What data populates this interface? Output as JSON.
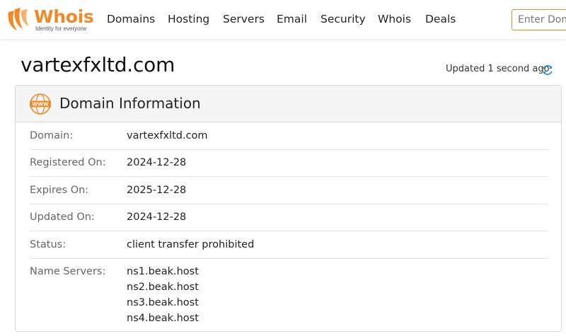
{
  "brand": {
    "name": "Whois",
    "tagline": "Identity for everyone",
    "color": "#f18a26"
  },
  "nav": {
    "items": [
      "Domains",
      "Hosting",
      "Servers",
      "Email",
      "Security",
      "Whois",
      "Deals"
    ]
  },
  "search": {
    "placeholder": "Enter Domain or IP"
  },
  "page": {
    "domain": "vartexfxltd.com",
    "updated_text": "Updated 1 second ago",
    "refresh_icon": "refresh-icon"
  },
  "card": {
    "icon": "www-icon",
    "title": "Domain Information",
    "rows": [
      {
        "label": "Domain:",
        "value": "vartexfxltd.com"
      },
      {
        "label": "Registered On:",
        "value": "2024-12-28"
      },
      {
        "label": "Expires On:",
        "value": "2025-12-28"
      },
      {
        "label": "Updated On:",
        "value": "2024-12-28"
      },
      {
        "label": "Status:",
        "value": "client transfer prohibited"
      },
      {
        "label": "Name Servers:",
        "values": [
          "ns1.beak.host",
          "ns2.beak.host",
          "ns3.beak.host",
          "ns4.beak.host"
        ]
      }
    ]
  }
}
